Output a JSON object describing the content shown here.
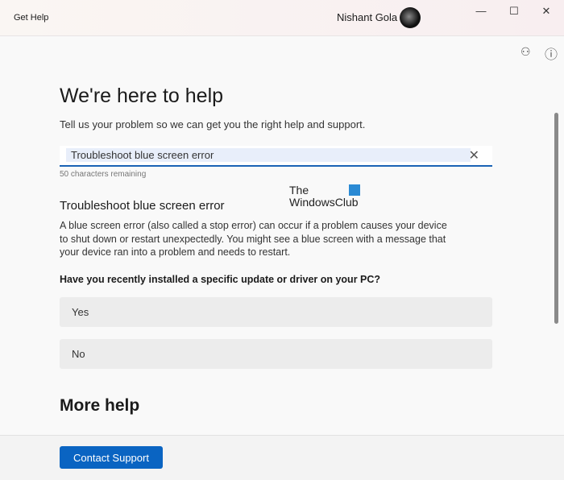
{
  "app": {
    "title": "Get Help",
    "user": "Nishant Gola"
  },
  "window": {
    "minimize": "—",
    "maximize": "☐",
    "close": "✕"
  },
  "toolbar": {
    "feedback_icon": "feedback-icon",
    "info_icon": "ⓘ"
  },
  "main": {
    "title": "We're here to help",
    "subtitle": "Tell us your problem so we can get you the right help and support.",
    "search": {
      "value": "Troubleshoot blue screen error",
      "clear": "✕",
      "remaining": "50 characters remaining"
    },
    "result_title": "Troubleshoot blue screen error",
    "result_text": "A blue screen error (also called a stop error) can occur if a problem causes your device to shut down or restart unexpectedly. You might see a blue screen with a message that your device ran into a problem and needs to restart.",
    "question": "Have you recently installed a specific update or driver on your PC?",
    "options": [
      "Yes",
      "No"
    ],
    "more_help": "More help"
  },
  "watermark": {
    "line1": "The",
    "line2": "WindowsClub"
  },
  "footer": {
    "contact": "Contact Support"
  },
  "colors": {
    "accent": "#0a64c2"
  }
}
